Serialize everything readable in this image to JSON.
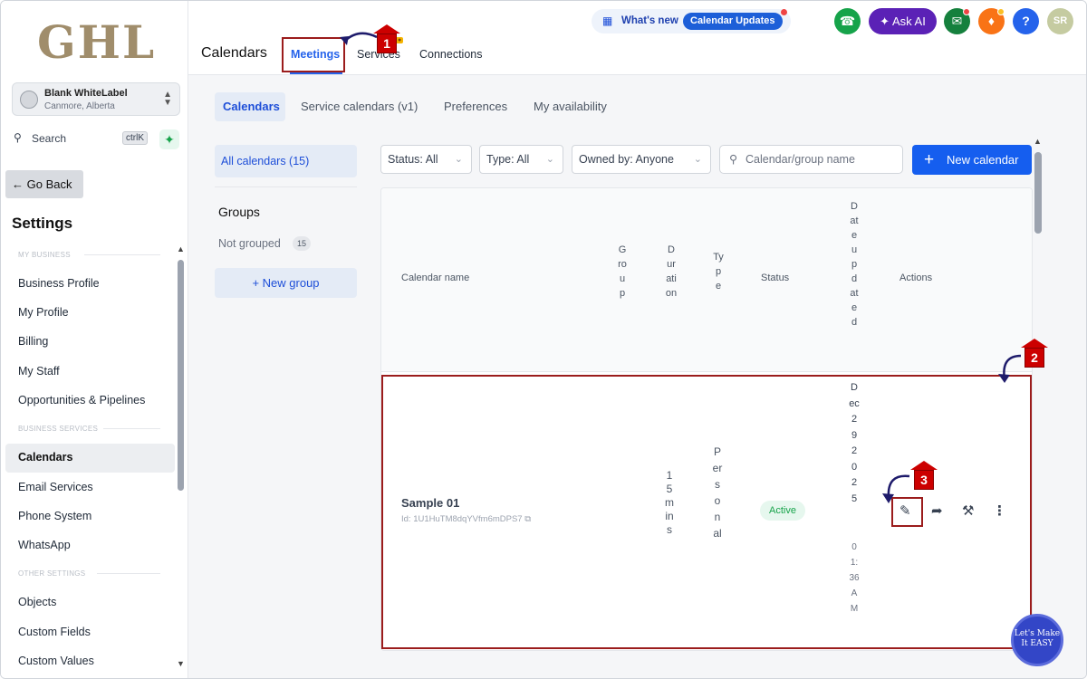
{
  "sidebar": {
    "logo": "GHL",
    "account": {
      "name": "Blank WhiteLabel",
      "location": "Canmore, Alberta"
    },
    "search": {
      "label": "Search",
      "shortcut": "ctrlK"
    },
    "go_back": "Go Back",
    "title": "Settings",
    "sections": {
      "my_business": "MY BUSINESS",
      "business_services": "BUSINESS SERVICES",
      "other_settings": "OTHER SETTINGS"
    },
    "items": [
      {
        "label": "Business Profile"
      },
      {
        "label": "My Profile"
      },
      {
        "label": "Billing"
      },
      {
        "label": "My Staff"
      },
      {
        "label": "Opportunities & Pipelines"
      },
      {
        "label": "Calendars"
      },
      {
        "label": "Email Services"
      },
      {
        "label": "Phone System"
      },
      {
        "label": "WhatsApp"
      },
      {
        "label": "Objects"
      },
      {
        "label": "Custom Fields"
      },
      {
        "label": "Custom Values"
      }
    ]
  },
  "topbar": {
    "whats_new": "What's new",
    "calendar_updates": "Calendar Updates",
    "ask_ai": "Ask AI",
    "user_initials": "SR",
    "help": "?",
    "page_title": "Calendars",
    "tabs": [
      "Meetings",
      "Services",
      "Connections"
    ]
  },
  "subtabs": [
    "Calendars",
    "Service calendars (v1)",
    "Preferences",
    "My availability"
  ],
  "left_panel": {
    "all_calendars": "All calendars (15)",
    "groups_title": "Groups",
    "not_grouped": "Not grouped",
    "not_grouped_count": "15",
    "new_group": "+ New group"
  },
  "filters": {
    "status": "Status: All",
    "type": "Type: All",
    "owned_by": "Owned by: Anyone",
    "search_placeholder": "Calendar/group name",
    "new_calendar": "New calendar"
  },
  "table": {
    "headers": {
      "name": "Calendar name",
      "group": "Group",
      "duration": "Duration",
      "type": "Type",
      "status": "Status",
      "date_updated": "Dateupdated",
      "actions": "Actions"
    },
    "rows": [
      {
        "name": "Sample 01",
        "id": "Id: 1U1HuTM8dqYVfm6mDPS7",
        "duration": "15mins",
        "type": "Personal",
        "status": "Active",
        "date_updated": "Dec292025",
        "time_updated": "01:36AM"
      }
    ]
  },
  "annotations": [
    "1",
    "2",
    "3"
  ],
  "chat_widget": "Let's Make It EASY",
  "colors": {
    "accent": "#155eef",
    "annotation": "#9b1c1c",
    "status_active": "#16a34a"
  }
}
